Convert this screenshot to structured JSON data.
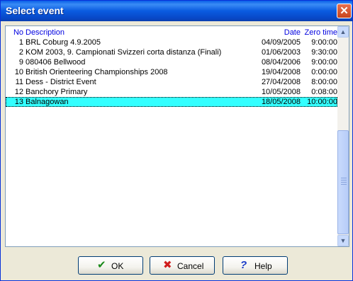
{
  "window": {
    "title": "Select event",
    "close_glyph": "✕",
    "close_icon": "close-icon"
  },
  "list": {
    "headers": {
      "no": "No",
      "description": "Description",
      "date": "Date",
      "zero_time": "Zero time"
    },
    "rows": [
      {
        "no": "1",
        "description": "BRL Coburg  4.9.2005",
        "date": "04/09/2005",
        "zero_time": "9:00:00"
      },
      {
        "no": "2",
        "description": "KOM 2003, 9. Campionati Svizzeri corta distanza (Finali)",
        "date": "01/06/2003",
        "zero_time": "9:30:00"
      },
      {
        "no": "9",
        "description": "080406 Bellwood",
        "date": "08/04/2006",
        "zero_time": "9:00:00"
      },
      {
        "no": "10",
        "description": "British Orienteering Championships 2008",
        "date": "19/04/2008",
        "zero_time": "0:00:00"
      },
      {
        "no": "11",
        "description": "Dess - District Event",
        "date": "27/04/2008",
        "zero_time": "8:00:00"
      },
      {
        "no": "12",
        "description": "Banchory Primary",
        "date": "10/05/2008",
        "zero_time": "0:08:00"
      },
      {
        "no": "13",
        "description": "Balnagowan",
        "date": "18/05/2008",
        "zero_time": "10:00:00",
        "selected": true
      }
    ],
    "selected_color": "#33ffff",
    "header_color": "#0000e0"
  },
  "scrollbar": {
    "up_glyph": "▲",
    "down_glyph": "▼",
    "up_icon": "scroll-up-arrow-icon",
    "down_icon": "scroll-down-arrow-icon"
  },
  "buttons": {
    "ok": {
      "label": "OK",
      "glyph": "✔",
      "icon": "checkmark-icon",
      "icon_color": "#1a8a1a"
    },
    "cancel": {
      "label": "Cancel",
      "glyph": "✖",
      "icon": "red-x-icon",
      "icon_color": "#d01c1c"
    },
    "help": {
      "label": "Help",
      "glyph": "?",
      "icon": "question-mark-icon",
      "icon_color": "#1a3cc8"
    }
  }
}
